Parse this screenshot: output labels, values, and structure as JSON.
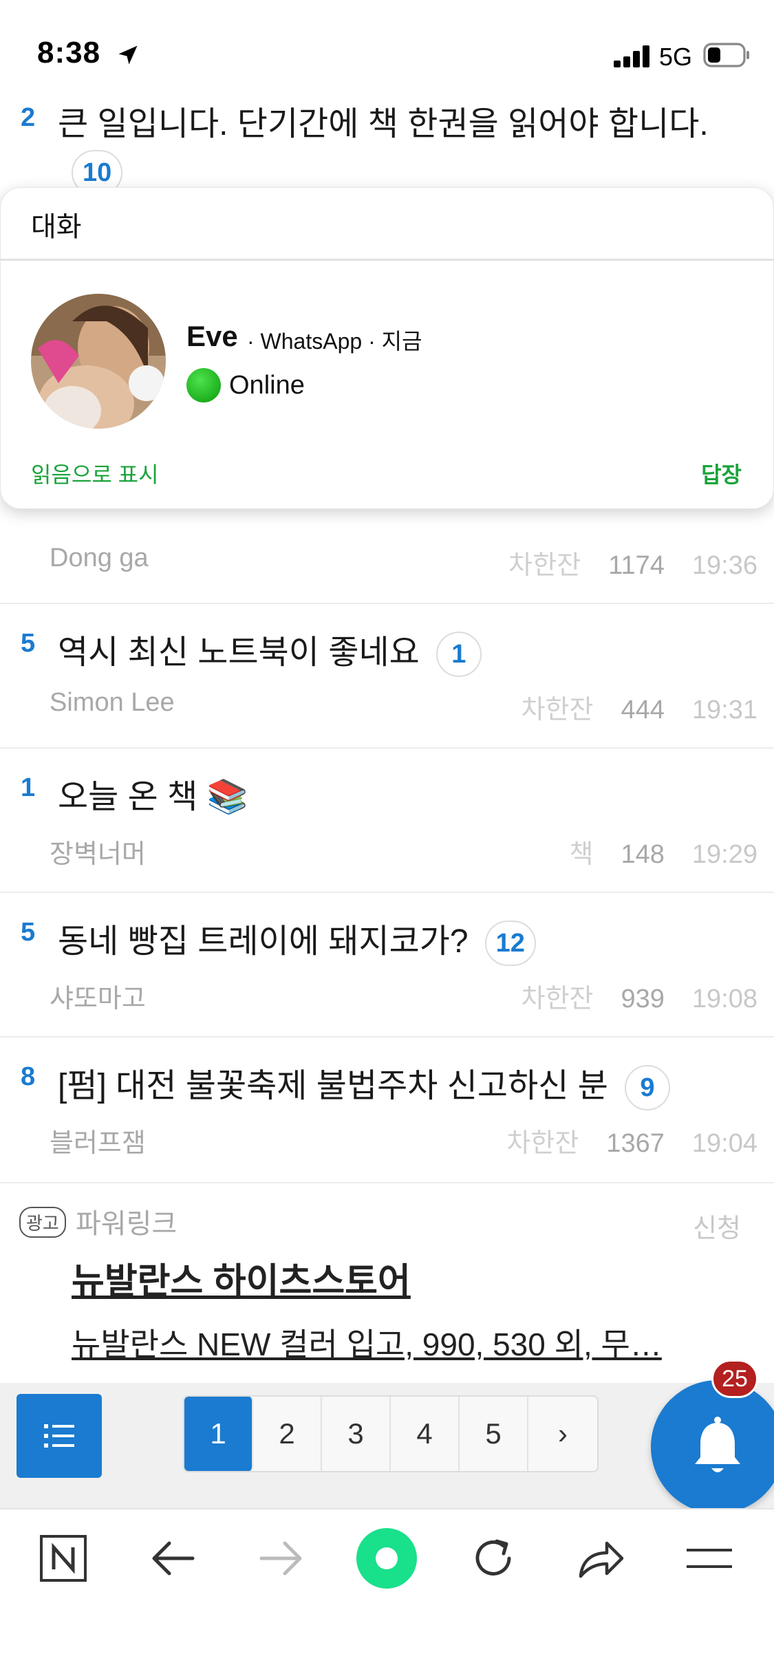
{
  "status_bar": {
    "time": "8:38",
    "network": "5G"
  },
  "top_partial": {
    "rank": "2",
    "title": "큰 일입니다. 단기간에 책 한권을 읽어야 합니다.",
    "comments": "10"
  },
  "notification": {
    "header": "대화",
    "name": "Eve",
    "source": "· WhatsApp · 지금",
    "status": "Online",
    "mark_read": "읽음으로 표시",
    "reply": "답장"
  },
  "posts": [
    {
      "rank": "",
      "title": "",
      "comments": "",
      "author": "Dong ga",
      "category": "차한잔",
      "views": "1174",
      "time": "19:36"
    },
    {
      "rank": "5",
      "title": "역시 최신 노트북이 좋네요",
      "comments": "1",
      "author": "Simon Lee",
      "category": "차한잔",
      "views": "444",
      "time": "19:31"
    },
    {
      "rank": "1",
      "title": "오늘 온 책 📚",
      "comments": "",
      "author": "장벽너머",
      "category": "책",
      "views": "148",
      "time": "19:29"
    },
    {
      "rank": "5",
      "title": "동네 빵집 트레이에 돼지코가?",
      "comments": "12",
      "author": "샤또마고",
      "category": "차한잔",
      "views": "939",
      "time": "19:08"
    },
    {
      "rank": "8",
      "title": "[펌] 대전 불꽃축제 불법주차 신고하신 분",
      "comments": "9",
      "author": "블러프잼",
      "category": "차한잔",
      "views": "1367",
      "time": "19:04"
    }
  ],
  "ad": {
    "badge": "광고",
    "label": "파워링크",
    "apply": "신청",
    "title": "뉴발란스 하이츠스토어",
    "description": "뉴발란스 NEW 컬러 입고, 990, 530 외, 무…"
  },
  "pagination": {
    "pages": [
      "1",
      "2",
      "3",
      "4",
      "5"
    ],
    "next": "›",
    "active": "1"
  },
  "notification_badge": "25",
  "browser_bar": {
    "icons": [
      "naver-n-icon",
      "back-arrow-icon",
      "forward-arrow-icon",
      "home-circle-icon",
      "reload-icon",
      "share-icon",
      "menu-icon"
    ]
  },
  "colors": {
    "accent": "#1a7bd0",
    "green": "#1aa33a",
    "badge": "#b3201f"
  }
}
